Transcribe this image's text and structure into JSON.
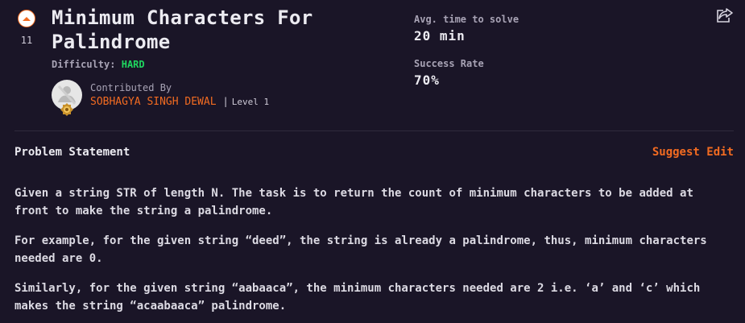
{
  "problem": {
    "title": "Minimum Characters For Palindrome",
    "vote_count": "11",
    "difficulty_label": "Difficulty:",
    "difficulty_value": "HARD"
  },
  "contributor": {
    "label": "Contributed By",
    "name": "SOBHAGYA SINGH DEWAL",
    "separator": "|",
    "level": "Level 1"
  },
  "stats": {
    "avg_time_label": "Avg. time to solve",
    "avg_time_value": "20 min",
    "success_rate_label": "Success Rate",
    "success_rate_value": "70%"
  },
  "section": {
    "title": "Problem Statement",
    "suggest_edit": "Suggest Edit"
  },
  "statement": {
    "paragraphs": [
      "Given a string STR of length N. The task is to return the count of minimum characters to be added at front to make the string a palindrome.",
      "For example, for the given string “deed”, the string is already a palindrome, thus, minimum characters needed are 0.",
      "Similarly, for the given string “aabaaca”, the minimum characters needed are 2 i.e. ‘a’ and ‘c’ which makes the string “acaabaaca” palindrome."
    ]
  },
  "icons": {
    "vote": "upvote-icon",
    "share": "share-icon",
    "avatar": "avatar-placeholder",
    "badge": "level-badge-icon"
  },
  "colors": {
    "background": "#1a1527",
    "accent": "#f26b21",
    "difficulty": "#1fd65f"
  }
}
